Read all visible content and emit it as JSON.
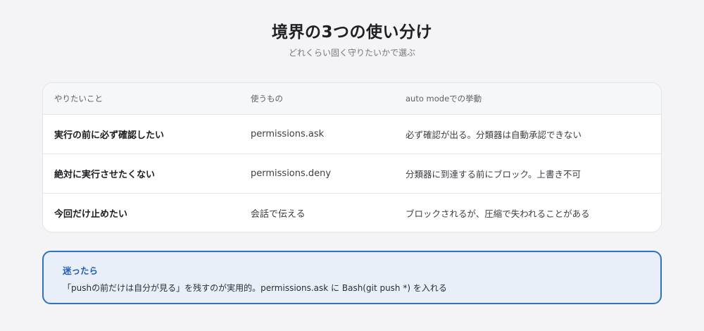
{
  "page": {
    "title": "境界の3つの使い分け",
    "subtitle": "どれくらい固く守りたいかで選ぶ"
  },
  "table": {
    "headers": [
      "やりたいこと",
      "使うもの",
      "auto modeでの挙動"
    ],
    "rows": [
      [
        "実行の前に必ず確認したい",
        "permissions.ask",
        "必ず確認が出る。分類器は自動承認できない"
      ],
      [
        "絶対に実行させたくない",
        "permissions.deny",
        "分類器に到達する前にブロック。上書き不可"
      ],
      [
        "今回だけ止めたい",
        "会話で伝える",
        "ブロックされるが、圧縮で失われることがある"
      ]
    ]
  },
  "note": {
    "title": "迷ったら",
    "text": "「pushの前だけは自分が見る」を残すのが実用的。permissions.ask に Bash(git push *) を入れる"
  },
  "colors": {
    "background": "#f4f4f6",
    "accent": "#2f72c2",
    "note_background": "#e8eff9"
  }
}
